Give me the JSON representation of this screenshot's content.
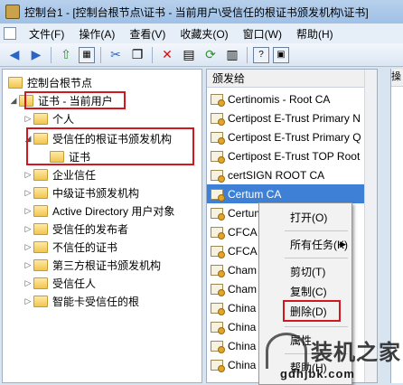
{
  "window": {
    "title": "控制台1 - [控制台根节点\\证书 - 当前用户\\受信任的根证书颁发机构\\证书]"
  },
  "menu": [
    "文件(F)",
    "操作(A)",
    "查看(V)",
    "收藏夹(O)",
    "窗口(W)",
    "帮助(H)"
  ],
  "toolbar": {
    "icons": [
      "back-icon",
      "forward-icon",
      "up-folder-icon",
      "show-tree-icon",
      "cut-icon",
      "copy-icon",
      "delete-icon",
      "properties-icon",
      "refresh-icon",
      "export-icon",
      "help-icon",
      "console-icon"
    ]
  },
  "tree": {
    "root": "控制台根节点",
    "cert_user": "证书 - 当前用户",
    "personal": "个人",
    "trusted_root": "受信任的根证书颁发机构",
    "certs": "证书",
    "enterprise": "企业信任",
    "intermediate": "中级证书颁发机构",
    "ad_user": "Active Directory 用户对象",
    "trusted_publishers": "受信任的发布者",
    "untrusted": "不信任的证书",
    "third_party_root": "第三方根证书颁发机构",
    "trusted_people": "受信任人",
    "smartcard_root": "智能卡受信任的根"
  },
  "list": {
    "header": "颁发给",
    "items": [
      "Certinomis - Root CA",
      "Certipost E-Trust Primary N",
      "Certipost E-Trust Primary Q",
      "Certipost E-Trust TOP Root",
      "certSIGN ROOT CA",
      "Certum CA",
      "Certum",
      "CFCA",
      "CFCA",
      "Cham",
      "Cham",
      "China",
      "China",
      "China",
      "China"
    ],
    "selected_index": 5
  },
  "actions_header": "操",
  "context_menu": {
    "open": "打开(O)",
    "all_tasks": "所有任务(K)",
    "cut": "剪切(T)",
    "copy": "复制(C)",
    "delete": "删除(D)",
    "properties": "属性",
    "help": "帮助(H)",
    "submenu_arrow": "▶"
  },
  "watermark": {
    "brand": "装机之家",
    "url": "gdhjbk.com"
  },
  "colors": {
    "highlight_box": "#d0181e",
    "selection": "#3d80d6"
  }
}
